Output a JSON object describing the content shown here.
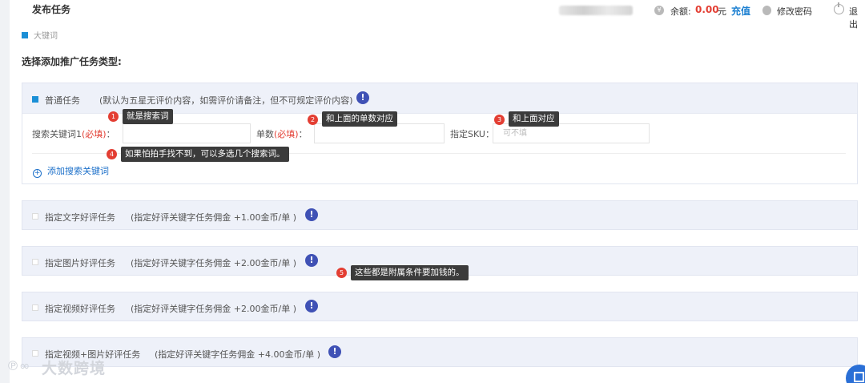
{
  "header": {
    "title": "发布任务",
    "balance_label": "余额:",
    "balance_value": "0.00",
    "balance_unit": "元",
    "recharge": "充值",
    "change_password": "修改密码",
    "logout": "退出"
  },
  "breadcrumb": {
    "text": "大键词"
  },
  "section_title": "选择添加推广任务类型:",
  "main_task": {
    "name": "普通任务",
    "note": "(默认为五星无评价内容，如需评价请备注，但不可规定评价内容)",
    "keyword_label": "搜索关键词1",
    "required": "(必填)",
    "colon": "：",
    "orders_label": "单数",
    "sku_label": "指定SKU：",
    "sku_placeholder": "可不填",
    "add_keyword": "添加搜索关键词"
  },
  "tasks": [
    {
      "name": "指定文字好评任务",
      "note": "(指定好评关键字任务佣金 +1.00金币/单 )"
    },
    {
      "name": "指定图片好评任务",
      "note": "(指定好评关键字任务佣金 +2.00金币/单 )"
    },
    {
      "name": "指定视频好评任务",
      "note": "(指定好评关键字任务佣金 +2.00金币/单 )"
    },
    {
      "name": "指定视频+图片好评任务",
      "note": "(指定好评关键字任务佣金 +4.00金币/单 )"
    }
  ],
  "annotations": [
    {
      "num": "1",
      "text": "就是搜索词"
    },
    {
      "num": "2",
      "text": "和上面的单数对应"
    },
    {
      "num": "3",
      "text": "和上面对应"
    },
    {
      "num": "4",
      "text": "如果怕拍手找不到，可以多选几个搜索词。"
    },
    {
      "num": "5",
      "text": "这些都是附属条件要加钱的。"
    }
  ],
  "watermark": "大数跨境",
  "colors": {
    "accent": "#1b8fd6",
    "danger": "#e33e33",
    "info_icon": "#3f51b5",
    "link": "#1b6fc9"
  },
  "icons": [
    "coin-icon",
    "lock-icon",
    "power-icon",
    "info-icon",
    "plus-circle-icon"
  ]
}
